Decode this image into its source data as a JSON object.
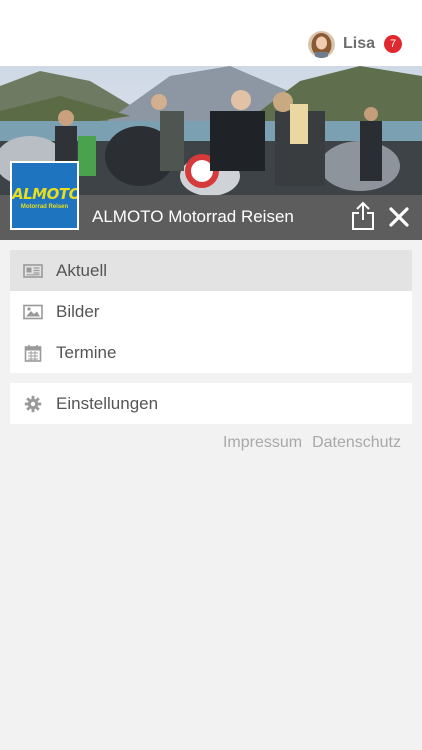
{
  "header": {
    "user_name": "Lisa",
    "notification_count": "7"
  },
  "hero": {
    "title": "ALMOTO Motorrad Reisen",
    "logo_text": "ALMOTO",
    "logo_subtext": "Motorrad Reisen"
  },
  "menu": {
    "items": [
      {
        "label": "Aktuell",
        "icon": "newspaper-icon",
        "active": true
      },
      {
        "label": "Bilder",
        "icon": "image-icon",
        "active": false
      },
      {
        "label": "Termine",
        "icon": "calendar-icon",
        "active": false
      }
    ],
    "settings": {
      "label": "Einstellungen",
      "icon": "gear-icon"
    }
  },
  "footer_links": {
    "impressum": "Impressum",
    "datenschutz": "Datenschutz"
  },
  "colors": {
    "badge": "#e0282f",
    "logo_bg": "#1f74c0",
    "logo_text": "#e8de1e",
    "active_item_bg": "#e3e3e3"
  }
}
